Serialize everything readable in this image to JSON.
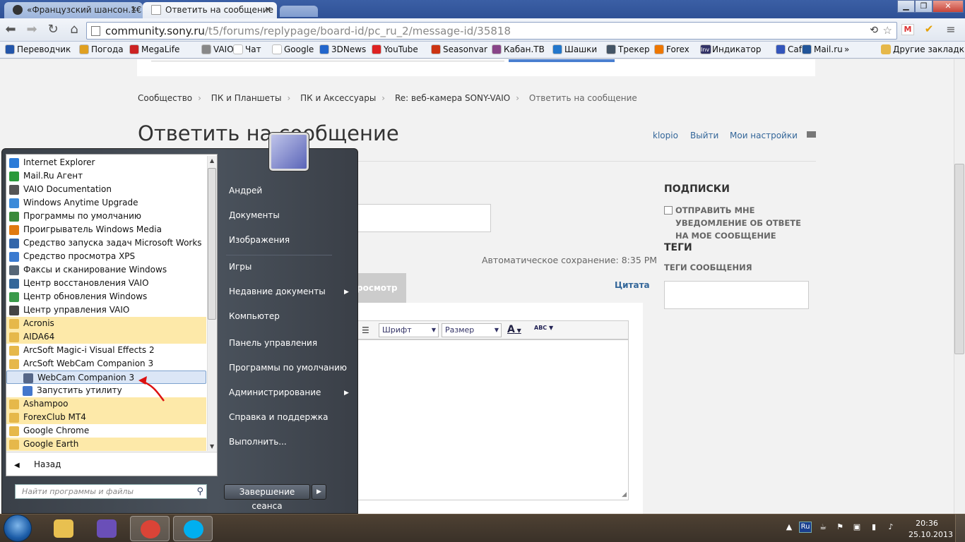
{
  "browser": {
    "tabs": [
      {
        "label": "«Французский шансон.1€"
      },
      {
        "label": "Ответить на сообщение"
      }
    ],
    "url_host": "community.sony.ru",
    "url_path": "/t5/forums/replypage/board-id/pc_ru_2/message-id/35818",
    "bookmarks": [
      {
        "label": "Переводчик",
        "color": "#2255aa"
      },
      {
        "label": "Погода",
        "color": "#e0a020"
      },
      {
        "label": "MegaLife",
        "color": "#cc2222"
      },
      {
        "label": "VAIO",
        "color": "#888888"
      },
      {
        "label": "Чат",
        "color": "#ffffff"
      },
      {
        "label": "Google",
        "color": "#ffffff"
      },
      {
        "label": "3DNews",
        "color": "#2266cc"
      },
      {
        "label": "YouTube",
        "color": "#dd2222"
      },
      {
        "label": "Seasonvar",
        "color": "#cc3311"
      },
      {
        "label": "Кабан.TB",
        "color": "#884488"
      },
      {
        "label": "Шашки",
        "color": "#2277cc"
      },
      {
        "label": "Трекер",
        "color": "#445566"
      },
      {
        "label": "Forex",
        "color": "#ee7700"
      },
      {
        "label": "Индикатор",
        "color": "#333366"
      },
      {
        "label": "Cafe",
        "color": "#3355bb"
      },
      {
        "label": "Mail.ru",
        "color": "#225599"
      }
    ],
    "bookmark_inv": "Inv",
    "bookmarks_more": "»",
    "other_bookmarks": "Другие закладки"
  },
  "page": {
    "breadcrumb": [
      "Сообщество",
      "ПК и Планшеты",
      "ПК и Аксессуары",
      "Re: веб-камера SONY-VAIO",
      "Ответить на сообщение"
    ],
    "breadcrumb_sep": "›",
    "title": "Ответить на сообщение",
    "user_links": {
      "user": "klopio",
      "logout": "Выйти",
      "settings": "Мои настройки"
    },
    "subscriptions_heading": "ПОДПИСКИ",
    "subscriptions_option": "ОТПРАВИТЬ МНЕ УВЕДОМЛЕНИЕ ОБ ОТВЕТЕ НА МОЕ СООБЩЕНИЕ",
    "tags_heading": "ТЕГИ",
    "tags_label": "ТЕГИ СООБЩЕНИЯ",
    "autosave": "Автоматическое сохранение: 8:35 PM",
    "preview_tab": "росмотр",
    "quote_link": "Цитата",
    "font_select": "Шрифт",
    "size_select": "Размер",
    "font_color_btn": "A",
    "spellcheck_btn": "ABC"
  },
  "startmenu": {
    "programs": [
      {
        "label": "Internet Explorer",
        "type": "app",
        "color": "#2b7bd8"
      },
      {
        "label": "Mail.Ru Агент",
        "type": "app",
        "color": "#2a9a3a"
      },
      {
        "label": "VAIO Documentation",
        "type": "app",
        "color": "#555555"
      },
      {
        "label": "Windows Anytime Upgrade",
        "type": "app",
        "color": "#3b8ad9"
      },
      {
        "label": "Программы по умолчанию",
        "type": "app",
        "color": "#3a8a3a"
      },
      {
        "label": "Проигрыватель Windows Media",
        "type": "app",
        "color": "#e07a10"
      },
      {
        "label": "Средство запуска задач Microsoft Works",
        "type": "app",
        "color": "#3366aa"
      },
      {
        "label": "Средство просмотра XPS",
        "type": "app",
        "color": "#3a7ad0"
      },
      {
        "label": "Факсы и сканирование Windows",
        "type": "app",
        "color": "#556677"
      },
      {
        "label": "Центр восстановления VAIO",
        "type": "app",
        "color": "#336699"
      },
      {
        "label": "Центр обновления Windows",
        "type": "app",
        "color": "#3a9a4a"
      },
      {
        "label": "Центр управления VAIO",
        "type": "app",
        "color": "#444444"
      },
      {
        "label": "Acronis",
        "type": "folder",
        "color": "#e6b84a"
      },
      {
        "label": "AIDA64",
        "type": "folder",
        "color": "#e6b84a"
      },
      {
        "label": "ArcSoft Magic-i Visual Effects 2",
        "type": "plainfolder",
        "color": "#e6b84a"
      },
      {
        "label": "ArcSoft WebCam Companion 3",
        "type": "plainfolder",
        "color": "#e6b84a"
      },
      {
        "label": "WebCam Companion 3",
        "type": "sub-selected",
        "color": "#556688"
      },
      {
        "label": "Запустить утилиту",
        "type": "sub",
        "color": "#4477cc"
      },
      {
        "label": "Ashampoo",
        "type": "folder",
        "color": "#e6b84a"
      },
      {
        "label": "ForexClub MT4",
        "type": "folder",
        "color": "#e6b84a"
      },
      {
        "label": "Google Chrome",
        "type": "plainfolder",
        "color": "#e6b84a"
      },
      {
        "label": "Google Earth",
        "type": "folder",
        "color": "#e6b84a"
      }
    ],
    "back_label": "Назад",
    "search_placeholder": "Найти программы и файлы",
    "right_items": [
      {
        "label": "Андрей"
      },
      {
        "label": "Документы"
      },
      {
        "label": "Изображения"
      },
      {
        "label": "Игры"
      },
      {
        "label": "Недавние документы",
        "arrow": true
      },
      {
        "label": "Компьютер"
      },
      {
        "label": "Панель управления"
      },
      {
        "label": "Программы по умолчанию"
      },
      {
        "label": "Администрирование",
        "arrow": true
      },
      {
        "label": "Справка и поддержка"
      },
      {
        "label": "Выполнить..."
      }
    ],
    "shutdown_label": "Завершение сеанса"
  },
  "taskbar": {
    "pinned": [
      {
        "name": "explorer",
        "color": "#e8c050"
      },
      {
        "name": "visual-studio",
        "color": "#6a4fb8"
      },
      {
        "name": "chrome",
        "color": "#db4437"
      },
      {
        "name": "skype",
        "color": "#00aff0"
      }
    ],
    "language": "Ru",
    "time": "20:36",
    "date": "25.10.2013"
  }
}
